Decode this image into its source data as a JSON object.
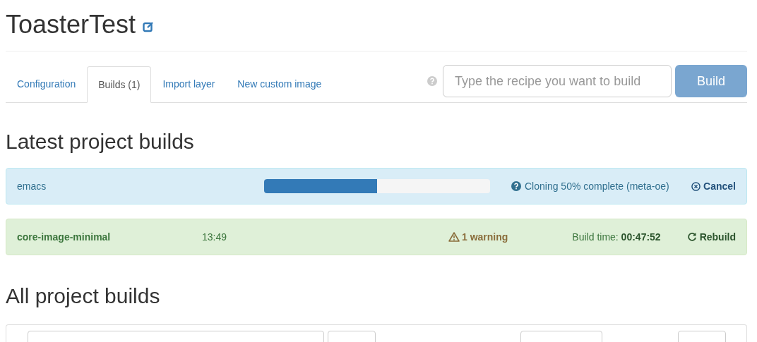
{
  "project": {
    "title": "ToasterTest"
  },
  "tabs": [
    {
      "label": "Configuration",
      "selected": false
    },
    {
      "label": "Builds (1)",
      "selected": true
    },
    {
      "label": "Import layer",
      "selected": false
    },
    {
      "label": "New custom image",
      "selected": false
    }
  ],
  "build_form": {
    "placeholder": "Type the recipe you want to build",
    "button": "Build"
  },
  "latest_heading": "Latest project builds",
  "builds": [
    {
      "kind": "in_progress",
      "recipe": "emacs",
      "level": 0.5,
      "status": "Cloning 50% complete (meta-oe)",
      "action": "Cancel"
    },
    {
      "kind": "completed",
      "recipe": "core-image-minimal",
      "time": "13:49",
      "warnings": "1 warning",
      "build_time_label": "Build time:",
      "build_time": "00:47:52",
      "action": "Rebuild"
    }
  ],
  "all_heading": "All project builds"
}
